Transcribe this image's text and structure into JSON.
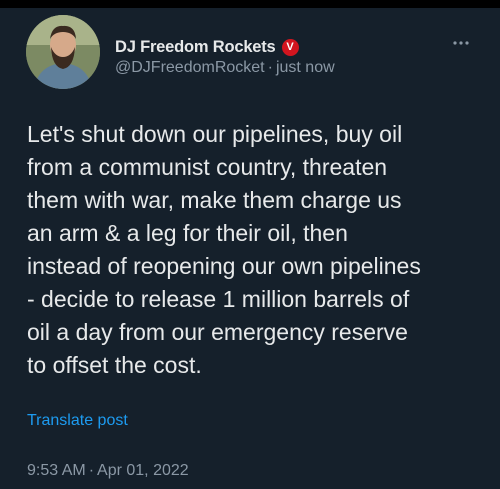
{
  "post": {
    "author": {
      "display_name": "DJ Freedom Rockets",
      "badge_letter": "V",
      "handle": "@DJFreedomRocket",
      "separator": "·",
      "relative_time": "just now"
    },
    "more_icon": "more-horizontal-icon",
    "text": "Let's shut down our pipelines, buy oil\nfrom a communist country, threaten\nthem with war, make them charge us\nan arm & a leg for their oil, then\ninstead of reopening our own pipelines\n- decide to release 1 million barrels of\noil a day from our emergency reserve\nto offset the cost.",
    "translate_label": "Translate post",
    "time": "9:53 AM",
    "time_separator": "·",
    "date": "Apr 01, 2022"
  },
  "colors": {
    "background": "#15202b",
    "text": "#e7e9ea",
    "muted": "#8b98a5",
    "link": "#1d9bf0",
    "badge": "#d2151f"
  }
}
